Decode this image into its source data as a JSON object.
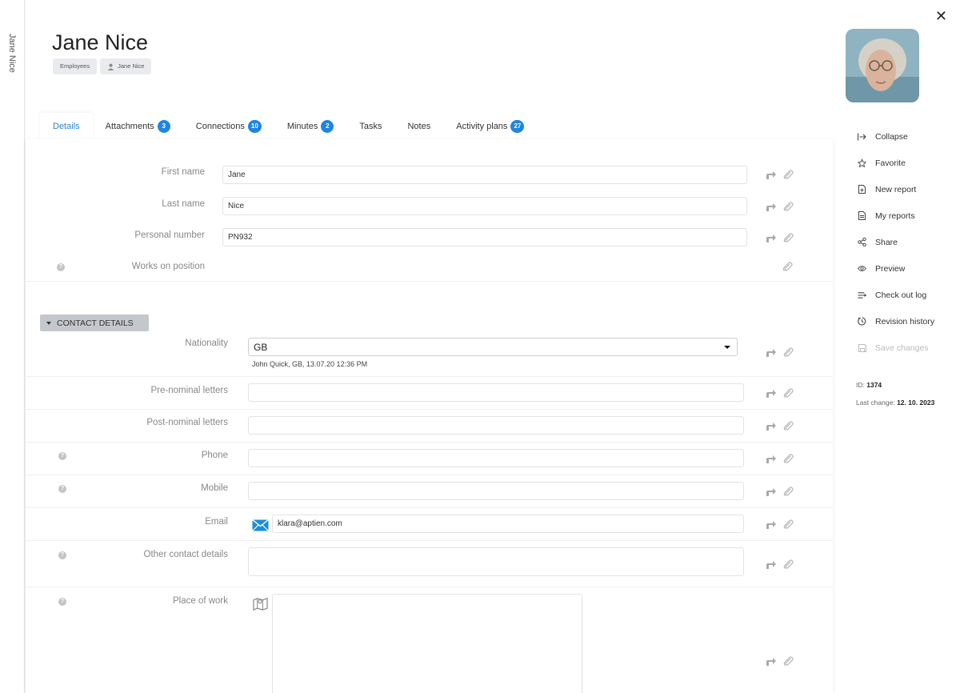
{
  "sidebar": {
    "vertical_name": "Jane Nice"
  },
  "header": {
    "title": "Jane Nice",
    "breadcrumbs": [
      "Employees",
      "Jane Nice"
    ]
  },
  "tabs": [
    {
      "label": "Details",
      "badge": null,
      "active": true
    },
    {
      "label": "Attachments",
      "badge": "3"
    },
    {
      "label": "Connections",
      "badge": "10"
    },
    {
      "label": "Minutes",
      "badge": "2"
    },
    {
      "label": "Tasks",
      "badge": null
    },
    {
      "label": "Notes",
      "badge": null
    },
    {
      "label": "Activity plans",
      "badge": "27"
    }
  ],
  "form": {
    "first_name": {
      "label": "First name",
      "value": "Jane"
    },
    "last_name": {
      "label": "Last name",
      "value": "Nice"
    },
    "personal_number": {
      "label": "Personal number",
      "value": "PN932"
    },
    "works_on_position": {
      "label": "Works on position"
    }
  },
  "contact": {
    "section_label": "CONTACT DETAILS",
    "nationality": {
      "label": "Nationality",
      "value": "GB",
      "note": "John Quick, GB, 13.07.20 12:36 PM"
    },
    "pre_nominal": {
      "label": "Pre-nominal letters",
      "value": ""
    },
    "post_nominal": {
      "label": "Post-nominal letters",
      "value": ""
    },
    "phone": {
      "label": "Phone",
      "value": ""
    },
    "mobile": {
      "label": "Mobile",
      "value": ""
    },
    "email": {
      "label": "Email",
      "value": "klara@aptien.com"
    },
    "other": {
      "label": "Other contact details",
      "value": ""
    },
    "place_of_work": {
      "label": "Place of work"
    }
  },
  "right_menu": {
    "items": [
      "Collapse",
      "Favorite",
      "New report",
      "My reports",
      "Share",
      "Preview",
      "Check out log",
      "Revision history",
      "Save changes"
    ],
    "id_label": "ID:",
    "id_value": "1374",
    "last_change_label": "Last change:",
    "last_change_value": "12. 10. 2023"
  },
  "colors": {
    "accent": "#1f86e0",
    "active_tab": "#2b86d6",
    "email_icon": "#1a8fd6"
  }
}
